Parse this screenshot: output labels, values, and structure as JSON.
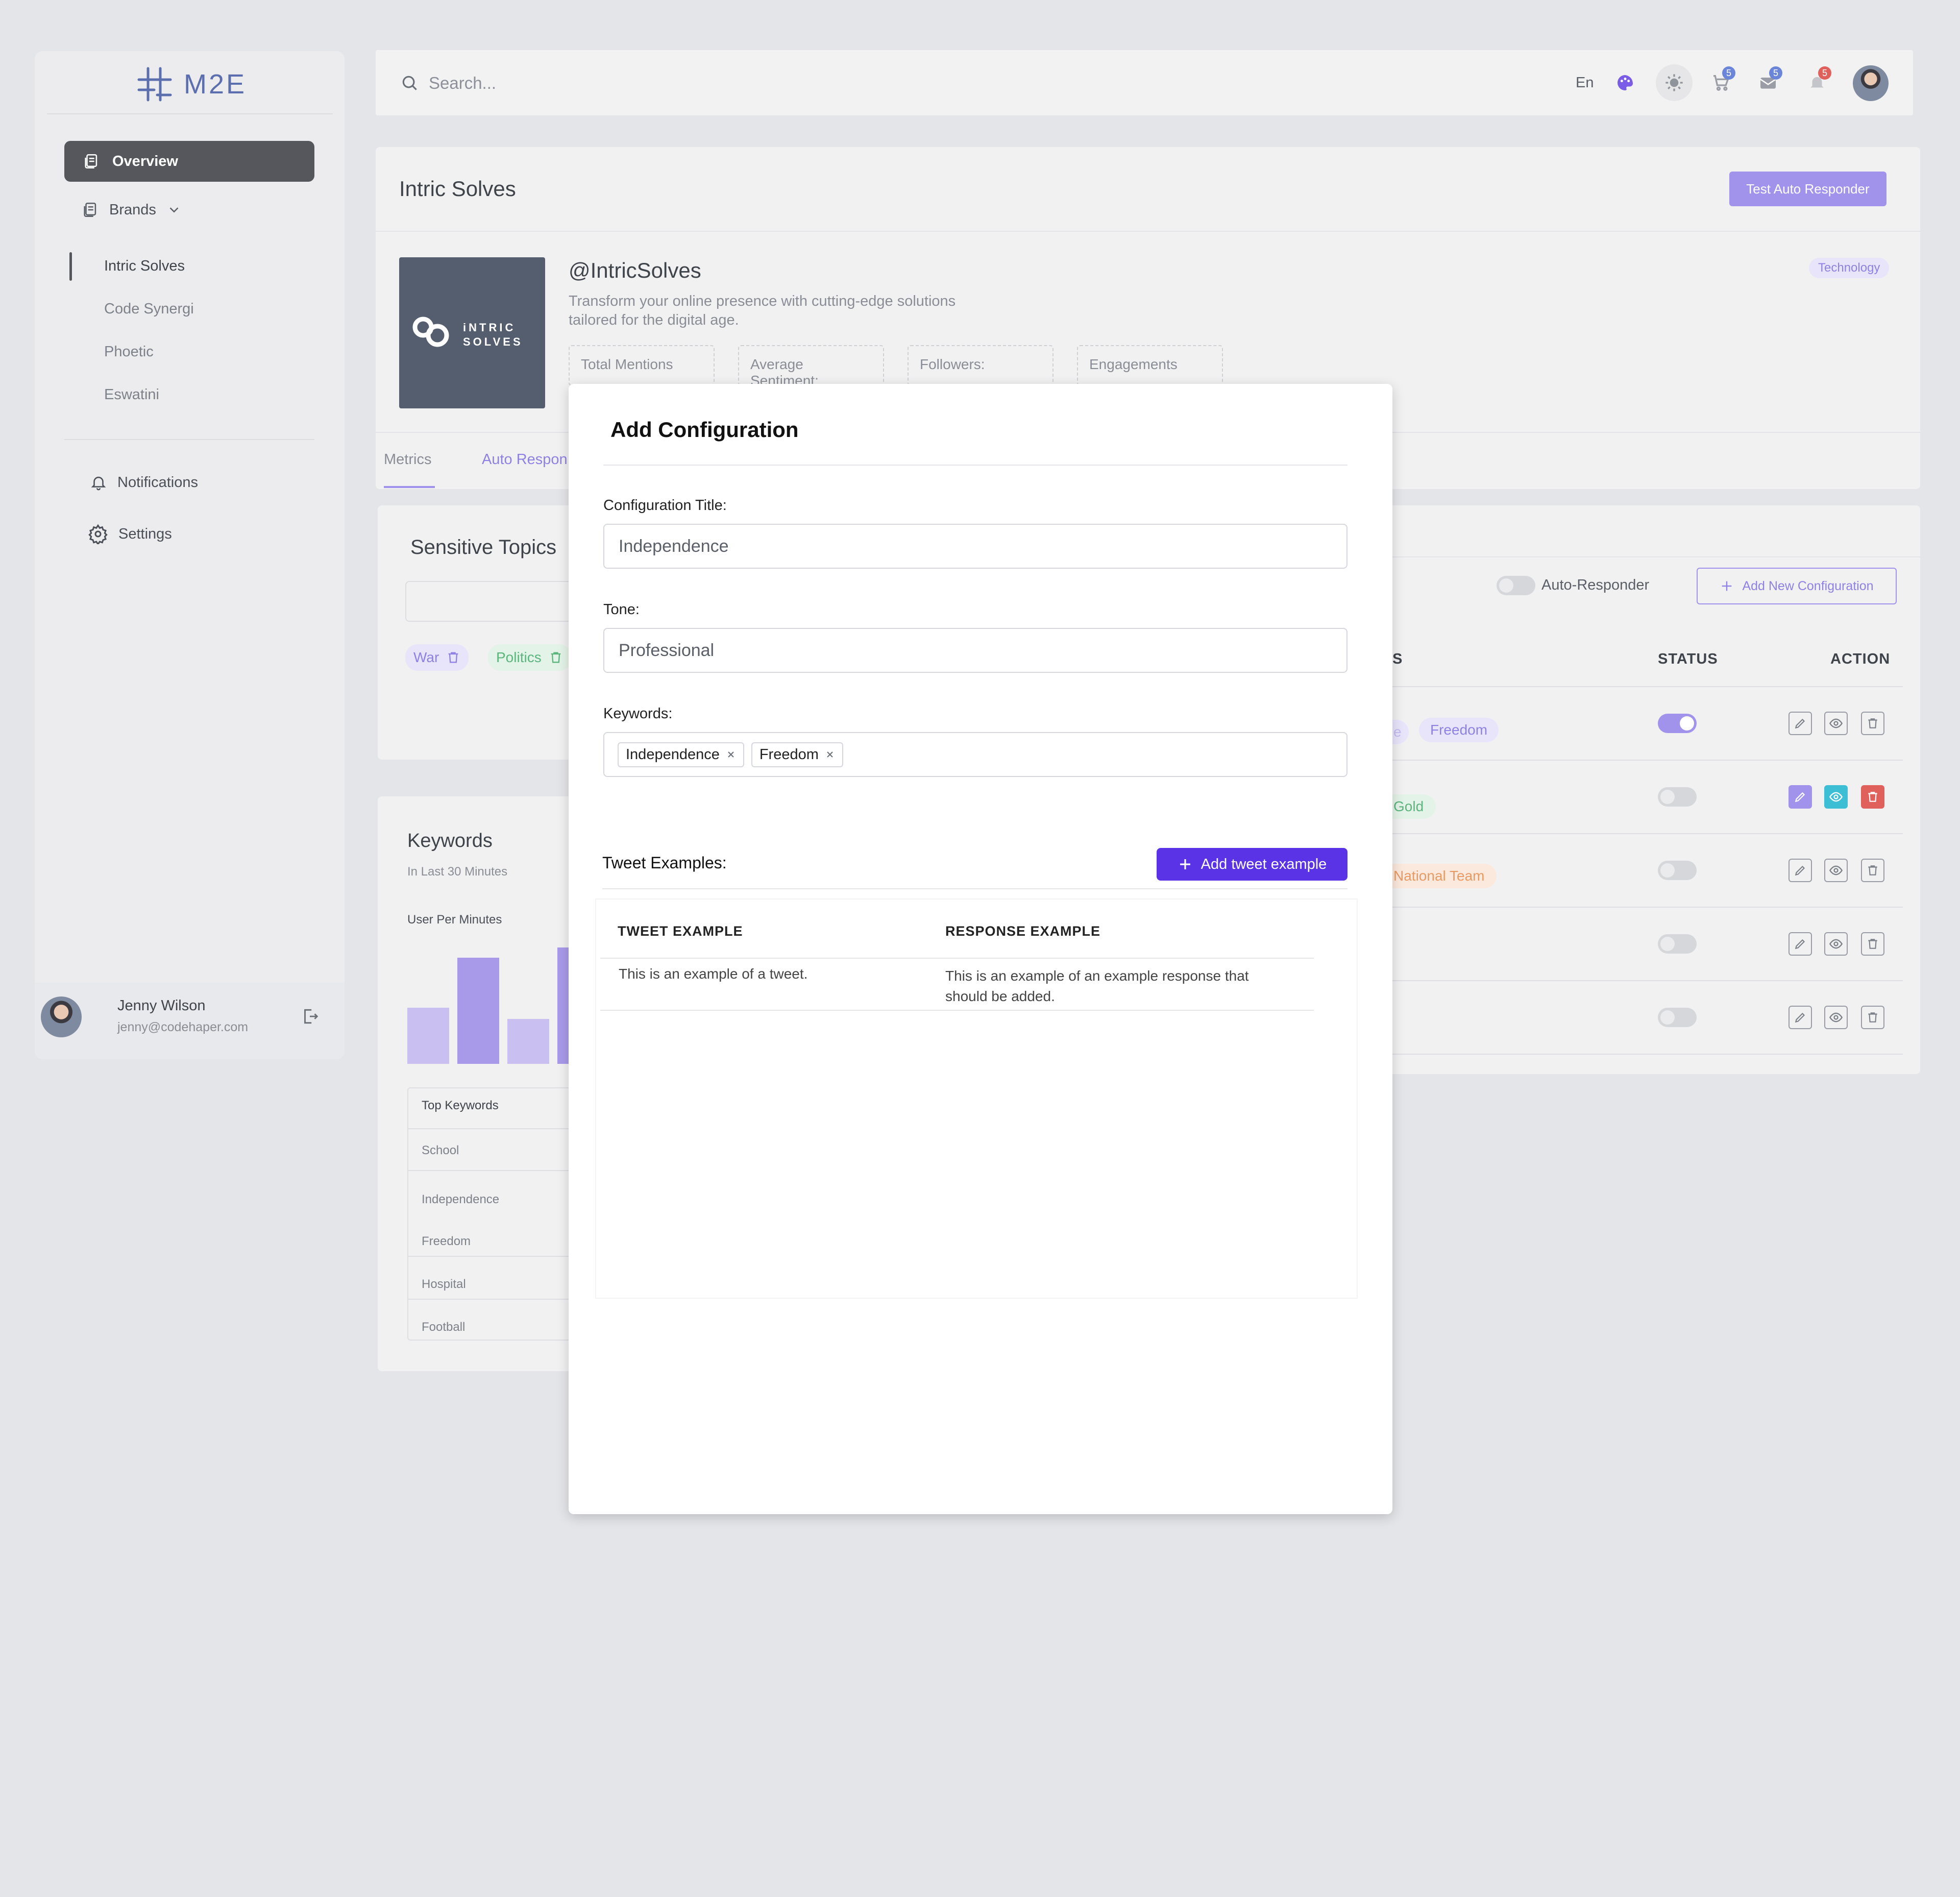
{
  "app": {
    "logo_text": "M2E"
  },
  "sidebar": {
    "overview": "Overview",
    "brands": "Brands",
    "brand_items": [
      "Intric Solves",
      "Code Synergi",
      "Phoetic",
      "Eswatini"
    ],
    "notifications": "Notifications",
    "settings": "Settings",
    "user": {
      "name": "Jenny Wilson",
      "email": "jenny@codehaper.com"
    }
  },
  "topbar": {
    "search_placeholder": "Search...",
    "language": "En",
    "cart_count": "5",
    "mail_count": "5",
    "bell_count": "5"
  },
  "brand": {
    "page_title": "Intric Solves",
    "test_button": "Test Auto Responder",
    "handle": "@IntricSolves",
    "description": "Transform your online presence with cutting-edge solutions tailored for the digital age.",
    "logo_line1": "iNTRIC",
    "logo_line2": "SOLVES",
    "category": "Technology",
    "stats": [
      "Total Mentions",
      "Average Sentiment:",
      "Followers:",
      "Engagements"
    ],
    "tabs": [
      "Metrics",
      "Auto Respon"
    ]
  },
  "sensitive": {
    "title": "Sensitive Topics",
    "chips": [
      "War",
      "Politics"
    ]
  },
  "keywords_card": {
    "title": "Keywords",
    "subtitle": "In Last 30 Minutes",
    "chart_label": "User Per Minutes",
    "top_header": "Top Keywords",
    "rows": [
      "School",
      "Independence",
      "Freedom",
      "Hospital",
      "Football"
    ]
  },
  "config_table": {
    "auto_responder": "Auto-Responder",
    "add_button": "Add New Configuration",
    "col_partial": "S",
    "col_status": "STATUS",
    "col_action": "ACTION",
    "row_keywords": [
      "Freedom",
      "Gold",
      "National Team",
      "",
      ""
    ],
    "row_prefix": "e",
    "toggles": [
      true,
      false,
      false,
      false,
      false
    ]
  },
  "modal": {
    "title": "Add Configuration",
    "config_title_label": "Configuration Title:",
    "config_title_value": "Independence",
    "tone_label": "Tone:",
    "tone_value": "Professional",
    "keywords_label": "Keywords:",
    "keywords": [
      "Independence",
      "Freedom"
    ],
    "tweet_examples_label": "Tweet Examples:",
    "add_tweet_button": "Add tweet example",
    "col_tweet": "TWEET EXAMPLE",
    "col_response": "RESPONSE EXAMPLE",
    "tweet": "This is an example of a tweet.",
    "response": "This is an example of an example response that should be added."
  },
  "colors": {
    "accent": "#5b33e6",
    "accent_light": "#a193ec",
    "sidebar_active": "#55575c"
  }
}
